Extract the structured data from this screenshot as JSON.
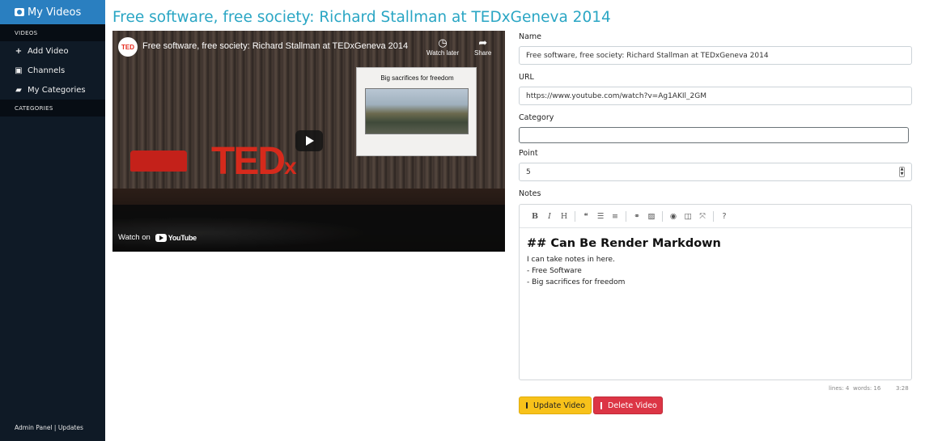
{
  "sidebar": {
    "brand": "My Videos",
    "videos_header": "VIDEOS",
    "items": [
      {
        "icon": "plus-icon",
        "label": "Add Video"
      },
      {
        "icon": "youtube-icon",
        "label": "Channels"
      },
      {
        "icon": "book-icon",
        "label": "My Categories"
      }
    ],
    "categories_header": "CATEGORIES",
    "footer": "Admin Panel | Updates"
  },
  "page": {
    "title": "Free software, free society: Richard Stallman at TEDxGeneva 2014"
  },
  "video": {
    "channel_logo": "TED",
    "title": "Free software, free society: Richard Stallman at TEDxGeneva 2014",
    "watch_later": "Watch later",
    "share": "Share",
    "watch_on": "Watch on",
    "youtube": "YouTube",
    "stage_logo": "TED",
    "stage_logo_x": "x",
    "slide_title": "Big sacrifices for freedom"
  },
  "form": {
    "name_label": "Name",
    "name_value": "Free software, free society: Richard Stallman at TEDxGeneva 2014",
    "url_label": "URL",
    "url_value": "https://www.youtube.com/watch?v=Ag1AKIl_2GM",
    "category_label": "Category",
    "category_value": "",
    "point_label": "Point",
    "point_value": "5",
    "notes_label": "Notes"
  },
  "editor": {
    "heading": "## Can Be Render Markdown",
    "lines": [
      "I can take notes in here.",
      "- Free Software",
      "- Big sacrifices for freedom"
    ],
    "status_lines": "lines: 4",
    "status_words": "words: 16",
    "status_cursor": "3:28"
  },
  "buttons": {
    "update": "Update Video",
    "delete": "Delete Video"
  },
  "colors": {
    "accent": "#2aa6c4",
    "sidebar_bg": "#0f1a26",
    "brand_bg": "#2a7fc0",
    "update_btn": "#f8c21a",
    "delete_btn": "#dc3545"
  }
}
